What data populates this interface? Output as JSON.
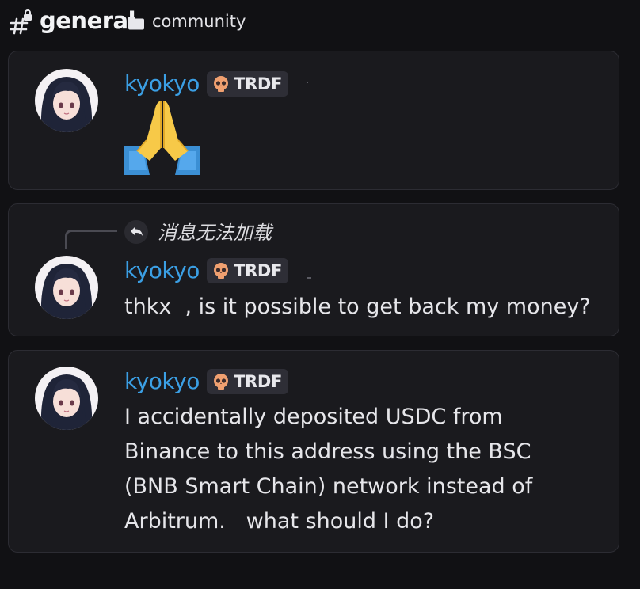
{
  "channel": {
    "name": "general",
    "category": "community"
  },
  "messages": [
    {
      "username": "kyokyo",
      "tag": "TRDF",
      "emoji": "folded-hands"
    },
    {
      "reply_text": "消息无法加载",
      "username": "kyokyo",
      "tag": "TRDF",
      "text": "thkx  , is it possible to get back my money?"
    },
    {
      "username": "kyokyo",
      "tag": "TRDF",
      "text_lines": [
        "I accidentally deposited USDC from",
        "Binance to this address using the BSC",
        "(BNB Smart Chain) network instead of",
        "Arbitrum.   what should I do?"
      ]
    }
  ],
  "colors": {
    "background": "#111114",
    "card": "#1a1a1e",
    "username": "#3b9fe4",
    "tag_bg": "#2e2e36",
    "skull": "#f0a070"
  },
  "icons": {
    "channel": "text-channel-lock-icon",
    "category": "folder-icon",
    "reply": "reply-arrow-icon",
    "tag": "skull-icon"
  }
}
